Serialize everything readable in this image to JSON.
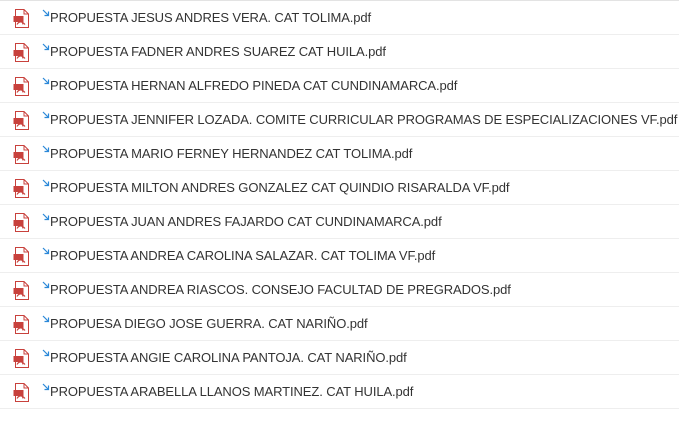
{
  "files": [
    {
      "name": "PROPUESTA JESUS ANDRES VERA. CAT TOLIMA.pdf",
      "icon": "pdf-file-icon"
    },
    {
      "name": "PROPUESTA FADNER ANDRES SUAREZ CAT HUILA.pdf",
      "icon": "pdf-file-icon"
    },
    {
      "name": "PROPUESTA HERNAN ALFREDO PINEDA CAT CUNDINAMARCA.pdf",
      "icon": "pdf-file-icon"
    },
    {
      "name": "PROPUESTA JENNIFER LOZADA. COMITE CURRICULAR PROGRAMAS DE ESPECIALIZACIONES VF.pdf",
      "icon": "pdf-file-icon"
    },
    {
      "name": "PROPUESTA MARIO FERNEY HERNANDEZ CAT TOLIMA.pdf",
      "icon": "pdf-file-icon"
    },
    {
      "name": "PROPUESTA MILTON ANDRES GONZALEZ CAT QUINDIO RISARALDA VF.pdf",
      "icon": "pdf-file-icon"
    },
    {
      "name": "PROPUESTA JUAN ANDRES FAJARDO CAT CUNDINAMARCA.pdf",
      "icon": "pdf-file-icon"
    },
    {
      "name": "PROPUESTA ANDREA CAROLINA SALAZAR. CAT TOLIMA VF.pdf",
      "icon": "pdf-file-icon"
    },
    {
      "name": "PROPUESTA ANDREA RIASCOS. CONSEJO FACULTAD DE PREGRADOS.pdf",
      "icon": "pdf-file-icon"
    },
    {
      "name": "PROPUESA DIEGO JOSE GUERRA. CAT NARIÑO.pdf",
      "icon": "pdf-file-icon"
    },
    {
      "name": "PROPUESTA ANGIE CAROLINA PANTOJA. CAT NARIÑO.pdf",
      "icon": "pdf-file-icon"
    },
    {
      "name": "PROPUESTA ARABELLA LLANOS MARTINEZ. CAT HUILA.pdf",
      "icon": "pdf-file-icon"
    }
  ],
  "colors": {
    "pdf_icon": "#c8413c",
    "shortcut_arrow": "#2b88d8",
    "text": "#333333",
    "row_border": "#eeeeee"
  }
}
